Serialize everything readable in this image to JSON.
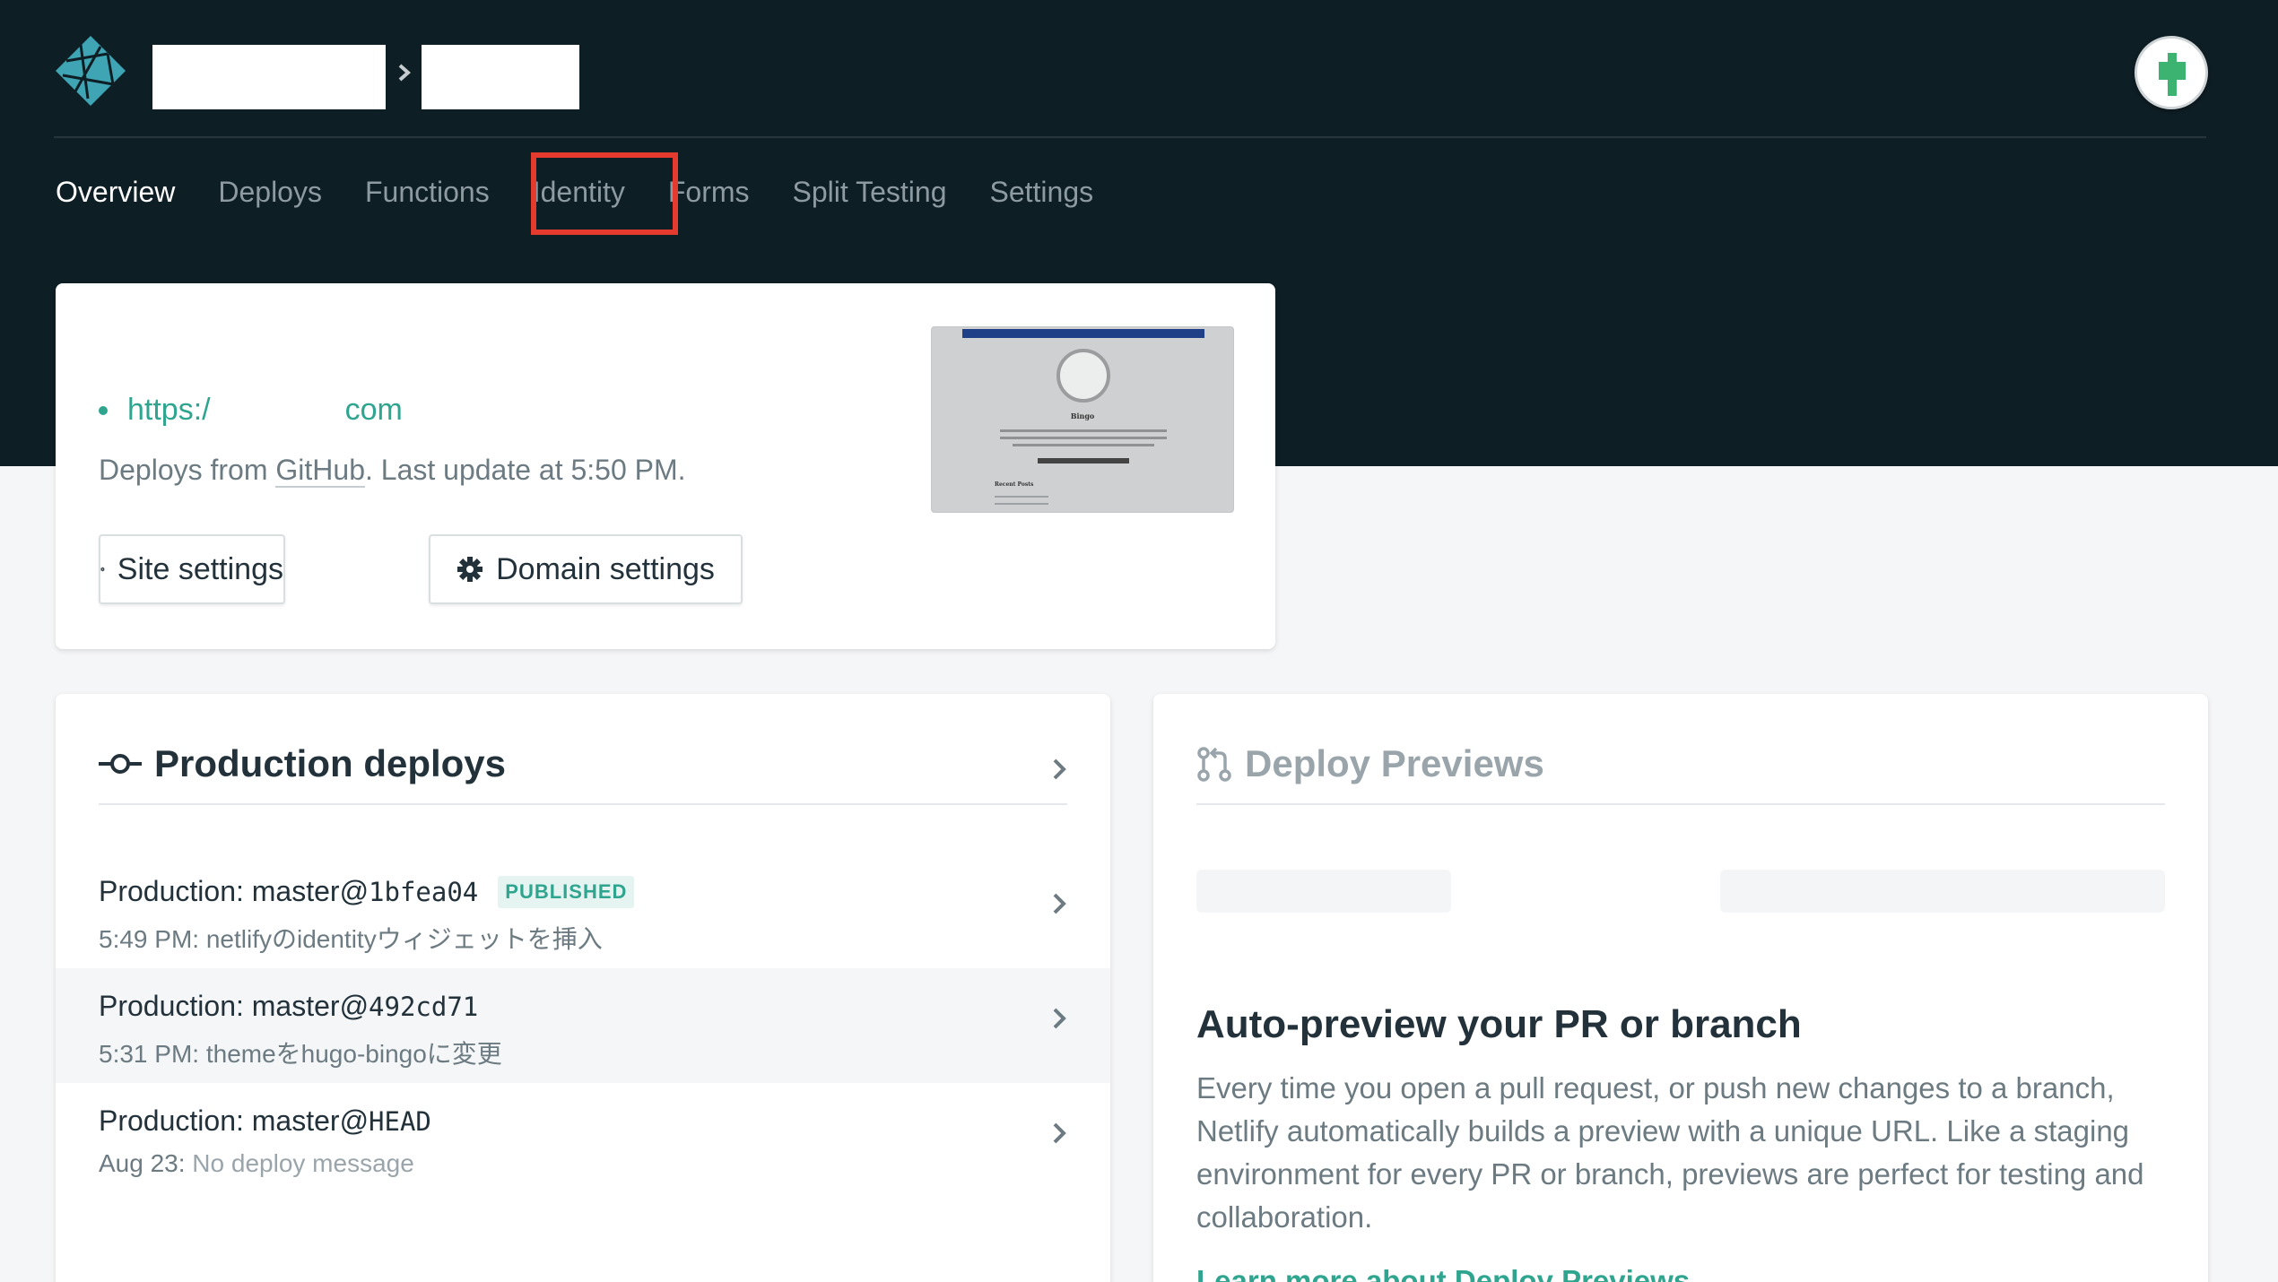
{
  "nav": {
    "tabs": [
      {
        "label": "Overview",
        "active": true
      },
      {
        "label": "Deploys"
      },
      {
        "label": "Functions"
      },
      {
        "label": "Identity",
        "highlighted": true
      },
      {
        "label": "Forms"
      },
      {
        "label": "Split Testing"
      },
      {
        "label": "Settings"
      }
    ]
  },
  "site": {
    "url_start": "https:/",
    "url_end": "com",
    "deploys_prefix": "Deploys from",
    "deploys_link": "GitHub",
    "deploys_suffix": ". Last update at 5:50 PM.",
    "site_settings_label": "Site settings",
    "domain_settings_label": "Domain settings",
    "thumb_title": "Bingo",
    "thumb_recent": "Recent Posts"
  },
  "production": {
    "title": "Production deploys",
    "rows": [
      {
        "label": "Production: master@",
        "ref": "1bfea04",
        "badge": "PUBLISHED",
        "time": "5:49 PM:",
        "message": " netlifyのidentityウィジェットを挿入"
      },
      {
        "label": "Production: master@",
        "ref": "492cd71",
        "time": "5:31 PM:",
        "message": " themeをhugo-bingoに変更"
      },
      {
        "label": "Production: master@",
        "ref": "HEAD",
        "time": "Aug 23:",
        "message": " No deploy message"
      }
    ]
  },
  "previews": {
    "title": "Deploy Previews",
    "heading": "Auto-preview your PR or branch",
    "body": "Every time you open a pull request, or push new changes to a branch, Netlify automatically builds a preview with a unique URL. Like a staging environment for every PR or branch, previews are perfect for testing and collaboration.",
    "learn_more": "Learn more about Deploy Previews"
  },
  "colors": {
    "header_bg": "#0e1e25",
    "accent": "#2fa58f",
    "highlight": "#e53b2f"
  }
}
